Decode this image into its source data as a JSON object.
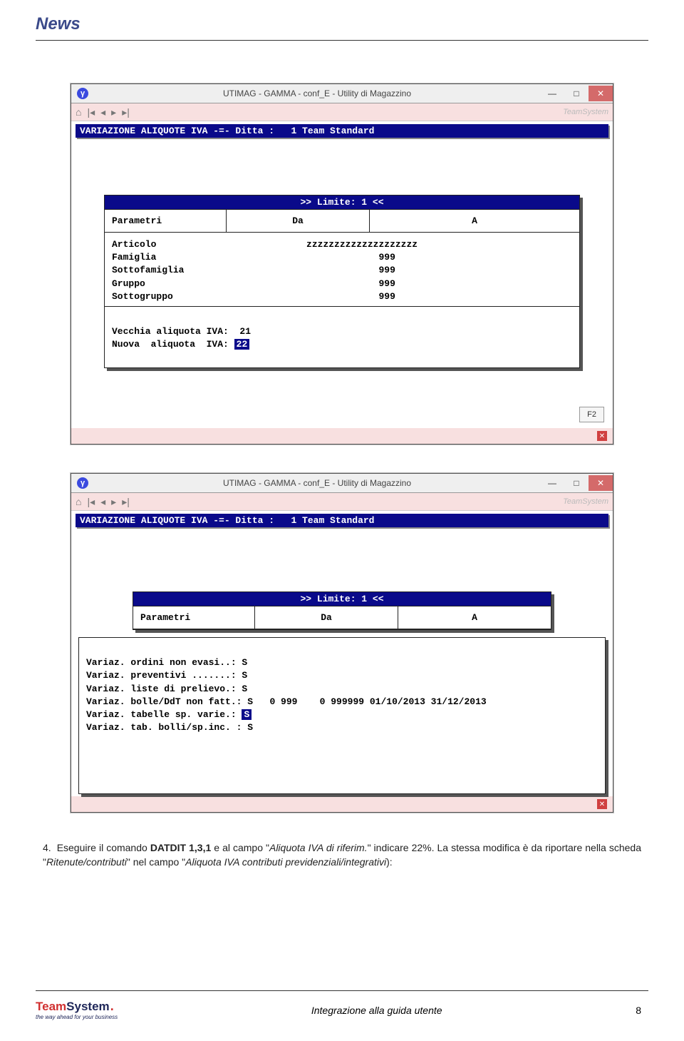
{
  "header": {
    "title": "News"
  },
  "window": {
    "title": "UTIMAG - GAMMA - conf_E - Utility di Magazzino",
    "icon_letter": "γ",
    "minimize": "—",
    "maximize": "□",
    "close": "✕",
    "brand": "TeamSystem"
  },
  "bluebar": "VARIAZIONE ALIQUOTE IVA -=- Ditta :   1 Team Standard",
  "limite": ">> Limite:   1 <<",
  "param_headers": {
    "p1": "Parametri",
    "p2": "Da",
    "p3": "A"
  },
  "screen1": {
    "rows": "Articolo                           zzzzzzzzzzzzzzzzzzzz\nFamiglia                                        999\nSottofamiglia                                   999\nGruppo                                          999\nSottogruppo                                     999",
    "vecchia": "Vecchia aliquota IVA:  21",
    "nuova_label": "Nuova  aliquota  IVA: ",
    "nuova_val": "22"
  },
  "f2": "F2",
  "screen2": {
    "lines_pre": "Variaz. ordini non evasi..: S\nVariaz. preventivi .......: S\nVariaz. liste di prelievo.: S\nVariaz. bolle/DdT non fatt.: S   0 999    0 999999 01/10/2013 31/12/2013",
    "line_cursor_label": "Variaz. tabelle sp. varie.: ",
    "line_cursor_val": "S",
    "lines_post": "Variaz. tab. bolli/sp.inc. : S"
  },
  "body": {
    "num": "4.",
    "pre": "Eseguire il comando ",
    "cmd": "DATDIT 1,3,1",
    "mid1": " e al campo \"",
    "f1": "Aliquota IVA di riferim.",
    "mid2": "\" indicare 22%. La stessa modifica è da riportare nella scheda \"",
    "f2": "Ritenute/contributi",
    "mid3": "\" nel campo \"",
    "f3": "Aliquota IVA contributi previdenziali/integrativi",
    "end": "):"
  },
  "footer": {
    "logo_team": "Team",
    "logo_system": "System",
    "logo_sub": "the way ahead for your business",
    "center": "Integrazione alla guida utente",
    "page": "8"
  }
}
